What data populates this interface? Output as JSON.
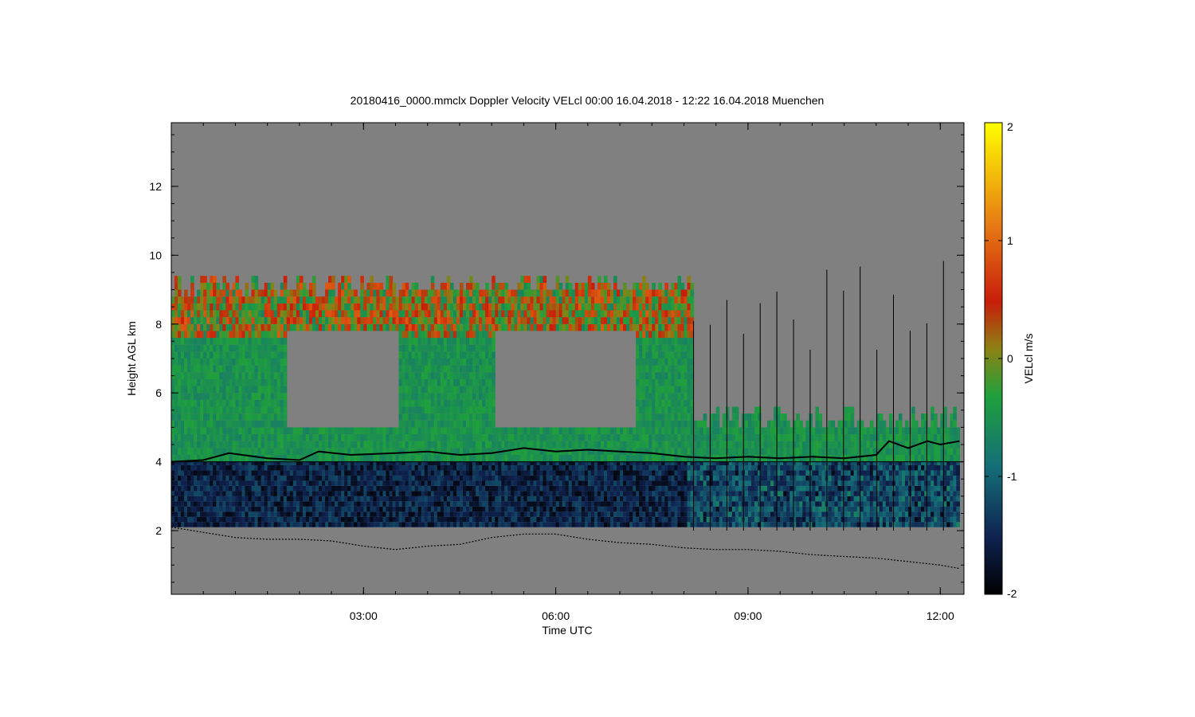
{
  "chart_data": {
    "type": "heatmap",
    "title": "20180416_0000.mmclx Doppler Velocity VELcl   00:00 16.04.2018 - 12:22 16.04.2018 Muenchen",
    "xlabel": "Time UTC",
    "ylabel": "Height AGL km",
    "xlim": [
      0,
      12.37
    ],
    "ylim": [
      0.15,
      13.85
    ],
    "x_tick_labels": [
      "03:00",
      "06:00",
      "09:00",
      "12:00"
    ],
    "x_ticks": [
      3,
      6,
      9,
      12
    ],
    "y_ticks": [
      2,
      4,
      6,
      8,
      10,
      12
    ],
    "y_tick_labels": [
      "2",
      "4",
      "6",
      "8",
      "10",
      "12"
    ],
    "colorbar": {
      "label": "VELcl m/s",
      "range": [
        -2,
        2
      ],
      "ticks": [
        -2,
        -1,
        0,
        1,
        2
      ],
      "tick_labels": [
        "-2",
        "-1",
        "0",
        "1",
        "2"
      ],
      "colors": [
        "#000000",
        "#0f2250",
        "#146e78",
        "#1fa03c",
        "#8c8214",
        "#c81e0a",
        "#e67814",
        "#ffff00"
      ]
    },
    "background_color": "#808080",
    "reference_line_km": 4.0,
    "series": [
      {
        "name": "",
        "x": [
          0,
          0.5,
          0.9,
          1.5,
          2.0,
          2.3,
          2.8,
          3.5,
          4.0,
          4.5,
          5.0,
          5.5,
          6.0,
          6.5,
          7.0,
          7.5,
          8.0,
          8.5,
          9.0,
          9.5,
          10.0,
          10.5,
          11.0,
          11.2,
          11.5,
          11.8,
          12.0,
          12.3
        ],
        "y": [
          4.0,
          4.05,
          4.25,
          4.1,
          4.05,
          4.3,
          4.2,
          4.25,
          4.3,
          4.2,
          4.25,
          4.4,
          4.3,
          4.35,
          4.3,
          4.25,
          4.15,
          4.1,
          4.15,
          4.1,
          4.15,
          4.1,
          4.2,
          4.6,
          4.4,
          4.6,
          4.5,
          4.6
        ]
      },
      {
        "name": "",
        "x": [
          0,
          0.5,
          1.0,
          1.5,
          2.0,
          2.5,
          3.0,
          3.5,
          4.0,
          4.5,
          5.0,
          5.5,
          6.0,
          6.5,
          7.0,
          7.5,
          8.0,
          8.5,
          9.0,
          9.5,
          10.0,
          10.5,
          11.0,
          11.5,
          12.0,
          12.3
        ],
        "y": [
          2.1,
          1.95,
          1.8,
          1.75,
          1.75,
          1.7,
          1.55,
          1.45,
          1.55,
          1.6,
          1.8,
          1.9,
          1.9,
          1.75,
          1.65,
          1.6,
          1.5,
          1.45,
          1.45,
          1.4,
          1.3,
          1.25,
          1.2,
          1.1,
          1.0,
          0.9
        ]
      }
    ]
  }
}
